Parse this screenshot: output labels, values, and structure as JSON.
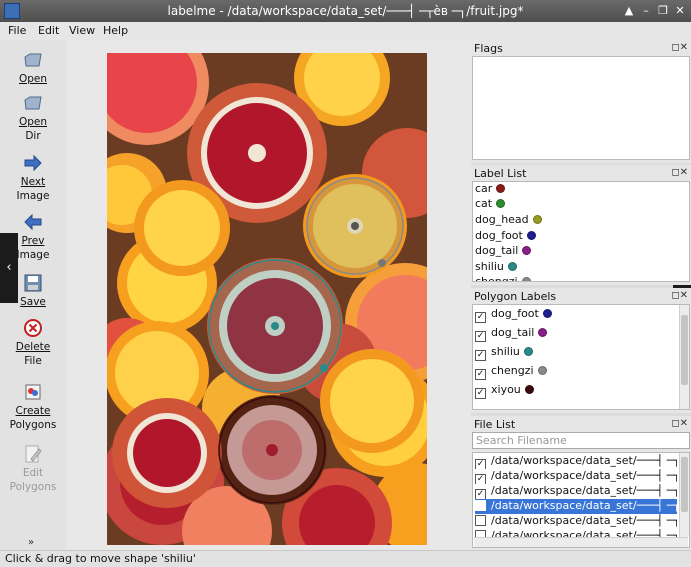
{
  "window": {
    "title": "labelme - /data/workspace/data_set/───┤ ─┬èв ─┐/fruit.jpg*"
  },
  "menu": {
    "file": "File",
    "edit": "Edit",
    "view": "View",
    "help": "Help"
  },
  "toolbar": {
    "open": "Open",
    "open_dir_1": "Open",
    "open_dir_2": "Dir",
    "next_1": "Next",
    "next_2": "Image",
    "prev_1": "Prev",
    "prev_2": "Image",
    "save": "Save",
    "delete_1": "Delete",
    "delete_2": "File",
    "create_1": "Create",
    "create_2": "Polygons",
    "edit_1": "Edit",
    "edit_2": "Polygons",
    "more": "»"
  },
  "flags": {
    "title": "Flags"
  },
  "label_list": {
    "title": "Label List",
    "items": [
      {
        "name": "car",
        "color": "#8b1a1a"
      },
      {
        "name": "cat",
        "color": "#2e8b2e"
      },
      {
        "name": "dog_head",
        "color": "#9a9a20"
      },
      {
        "name": "dog_foot",
        "color": "#1f1f8f"
      },
      {
        "name": "dog_tail",
        "color": "#8a1f8a"
      },
      {
        "name": "shiliu",
        "color": "#2a8a8a"
      },
      {
        "name": "chengzi",
        "color": "#8a8a8a"
      }
    ]
  },
  "polygon_labels": {
    "title": "Polygon Labels",
    "items": [
      {
        "name": "dog_foot",
        "color": "#1f1f8f",
        "checked": "✓"
      },
      {
        "name": "dog_tail",
        "color": "#8a1f8a",
        "checked": "✓"
      },
      {
        "name": "shiliu",
        "color": "#2a8a8a",
        "checked": "✓"
      },
      {
        "name": "chengzi",
        "color": "#8a8a8a",
        "checked": "✓"
      },
      {
        "name": "xiyou",
        "color": "#3a0a0a",
        "checked": "✓"
      }
    ]
  },
  "file_list": {
    "title": "File List",
    "search_placeholder": "Search Filename",
    "items": [
      {
        "path": "/data/workspace/data_set/───┤ ─┬èв",
        "checked": "✓"
      },
      {
        "path": "/data/workspace/data_set/───┤ ─┬èв",
        "checked": "✓"
      },
      {
        "path": "/data/workspace/data_set/───┤ ─┬èв",
        "checked": "✓"
      },
      {
        "path": "/data/workspace/data_set/───┤ ─┬èв",
        "checked": ""
      },
      {
        "path": "/data/workspace/data_set/───┤ ─┬èв",
        "checked": ""
      },
      {
        "path": "/data/workspace/data_set/───┤ ─┬èв",
        "checked": ""
      }
    ]
  },
  "status": {
    "text": "Click & drag to move shape 'shiliu'"
  }
}
